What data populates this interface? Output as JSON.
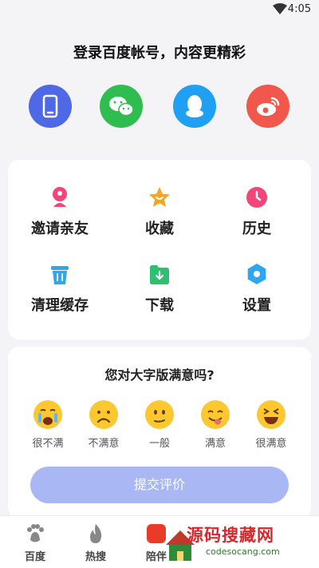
{
  "statusbar": {
    "time": "4:05"
  },
  "login": {
    "title": "登录百度帐号，内容更精彩"
  },
  "grid": [
    {
      "label": "邀请亲友",
      "icon": "invite-icon"
    },
    {
      "label": "收藏",
      "icon": "star-icon"
    },
    {
      "label": "历史",
      "icon": "clock-icon"
    },
    {
      "label": "清理缓存",
      "icon": "trash-icon"
    },
    {
      "label": "下载",
      "icon": "download-icon"
    },
    {
      "label": "设置",
      "icon": "settings-icon"
    }
  ],
  "survey": {
    "title": "您对大字版满意吗?",
    "options": [
      "很不满",
      "不满意",
      "一般",
      "满意",
      "很满意"
    ],
    "submit": "提交评价"
  },
  "tabs": [
    {
      "label": "百度",
      "icon": "baidu-paw-icon"
    },
    {
      "label": "热搜",
      "icon": "flame-icon"
    },
    {
      "label": "陪伴",
      "icon": "companion-icon"
    }
  ],
  "watermark": {
    "cn": "源码搜藏网",
    "en": "codesocang.com"
  }
}
